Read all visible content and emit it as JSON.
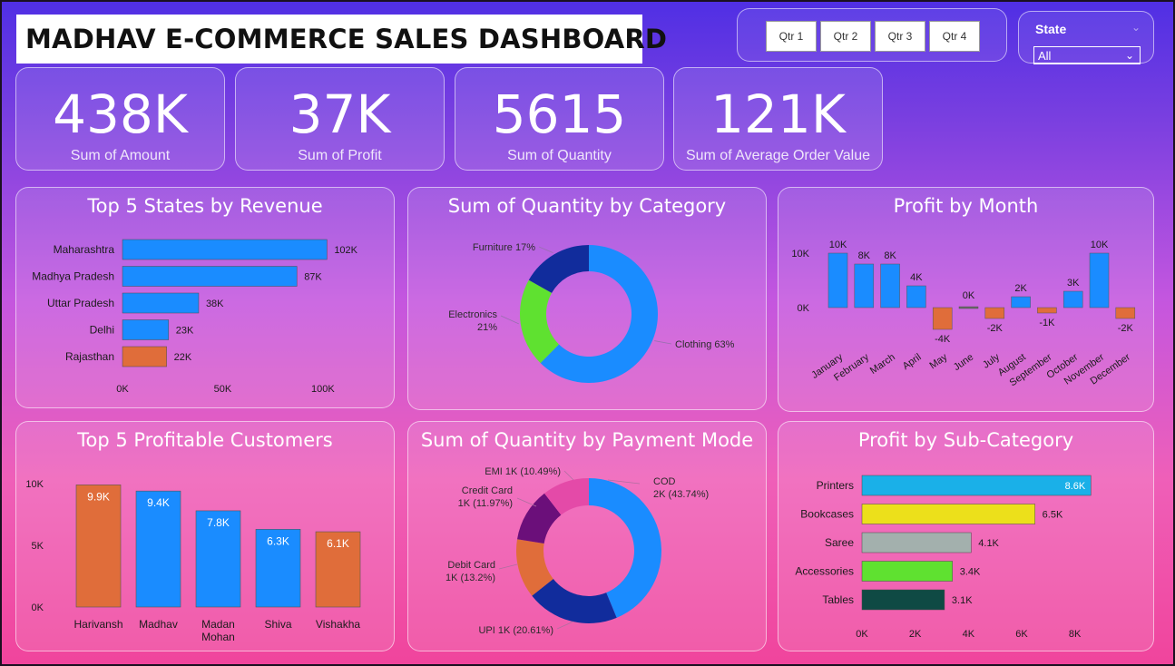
{
  "dashboard": {
    "title": "MADHAV E-COMMERCE SALES DASHBOARD"
  },
  "filters": {
    "quarters": [
      "Qtr 1",
      "Qtr 2",
      "Qtr 3",
      "Qtr 4"
    ],
    "state_label": "State",
    "state_value": "All"
  },
  "kpis": [
    {
      "value": "438K",
      "label": "Sum of Amount"
    },
    {
      "value": "37K",
      "label": "Sum of Profit"
    },
    {
      "value": "5615",
      "label": "Sum of Quantity"
    },
    {
      "value": "121K",
      "label": "Sum of Average Order Value"
    }
  ],
  "colors": {
    "blue": "#1a8cff",
    "orange": "#e06d3a",
    "navy": "#112c9c",
    "green": "#5fe130",
    "white": "#ffffff"
  },
  "chart_data": [
    {
      "type": "bar",
      "orientation": "horizontal",
      "title": "Top 5 States by Revenue",
      "categories": [
        "Maharashtra",
        "Madhya Pradesh",
        "Uttar Pradesh",
        "Delhi",
        "Rajasthan"
      ],
      "values": [
        102,
        87,
        38,
        23,
        22
      ],
      "data_labels": [
        "102K",
        "87K",
        "38K",
        "23K",
        "22K"
      ],
      "bar_colors": [
        "#1a8cff",
        "#1a8cff",
        "#1a8cff",
        "#1a8cff",
        "#e06d3a"
      ],
      "xticks": [
        "0K",
        "50K",
        "100K"
      ],
      "xtick_values": [
        0,
        50,
        100
      ],
      "xlim": [
        0,
        110
      ]
    },
    {
      "type": "pie",
      "donut": true,
      "title": "Sum of Quantity by Category",
      "categories": [
        "Clothing",
        "Electronics",
        "Furniture"
      ],
      "values": [
        63,
        21,
        17
      ],
      "labels": [
        "Clothing 63%",
        "Electronics 21%",
        "Furniture 17%"
      ],
      "colors": [
        "#1a8cff",
        "#5fe130",
        "#112c9c"
      ]
    },
    {
      "type": "bar",
      "title": "Profit by Month",
      "categories": [
        "January",
        "February",
        "March",
        "April",
        "May",
        "June",
        "July",
        "August",
        "September",
        "October",
        "November",
        "December"
      ],
      "values": [
        10,
        8,
        8,
        4,
        -4,
        0,
        -2,
        2,
        -1,
        3,
        10,
        -2
      ],
      "data_labels": [
        "10K",
        "8K",
        "8K",
        "4K",
        "-4K",
        "0K",
        "-2K",
        "2K",
        "-1K",
        "3K",
        "10K",
        "-2K"
      ],
      "yticks": [
        "10K",
        "0K"
      ],
      "ytick_values": [
        10,
        0
      ],
      "ylim": [
        -5,
        11
      ]
    },
    {
      "type": "bar",
      "title": "Top 5 Profitable Customers",
      "categories": [
        "Harivansh",
        "Madhav",
        "Madan Mohan",
        "Shiva",
        "Vishakha"
      ],
      "values": [
        9.9,
        9.4,
        7.8,
        6.3,
        6.1
      ],
      "data_labels": [
        "9.9K",
        "9.4K",
        "7.8K",
        "6.3K",
        "6.1K"
      ],
      "bar_colors": [
        "#e06d3a",
        "#1a8cff",
        "#1a8cff",
        "#1a8cff",
        "#e06d3a"
      ],
      "yticks": [
        "10K",
        "5K",
        "0K"
      ],
      "ytick_values": [
        10,
        5,
        0
      ],
      "ylim": [
        0,
        10
      ]
    },
    {
      "type": "pie",
      "donut": true,
      "title": "Sum of Quantity by Payment Mode",
      "categories": [
        "COD",
        "UPI",
        "Debit Card",
        "Credit Card",
        "EMI"
      ],
      "values": [
        43.74,
        20.61,
        13.2,
        11.97,
        10.49
      ],
      "labels": [
        "COD\n2K (43.74%)",
        "UPI 1K (20.61%)",
        "Debit Card\n1K (13.2%)",
        "Credit Card\n1K (11.97%)",
        "EMI 1K (10.49%)"
      ],
      "colors": [
        "#1a8cff",
        "#112c9c",
        "#e06d3a",
        "#6b0f7a",
        "#e44aa8"
      ]
    },
    {
      "type": "bar",
      "orientation": "horizontal",
      "title": "Profit by Sub-Category",
      "categories": [
        "Printers",
        "Bookcases",
        "Saree",
        "Accessories",
        "Tables"
      ],
      "values": [
        8.6,
        6.5,
        4.1,
        3.4,
        3.1
      ],
      "data_labels": [
        "8.6K",
        "6.5K",
        "4.1K",
        "3.4K",
        "3.1K"
      ],
      "bar_colors": [
        "#1ab0e8",
        "#ece01b",
        "#a3b0ad",
        "#5fe130",
        "#0f4a44"
      ],
      "xticks": [
        "0K",
        "2K",
        "4K",
        "6K",
        "8K"
      ],
      "xtick_values": [
        0,
        2,
        4,
        6,
        8
      ],
      "xlim": [
        0,
        9
      ]
    }
  ]
}
